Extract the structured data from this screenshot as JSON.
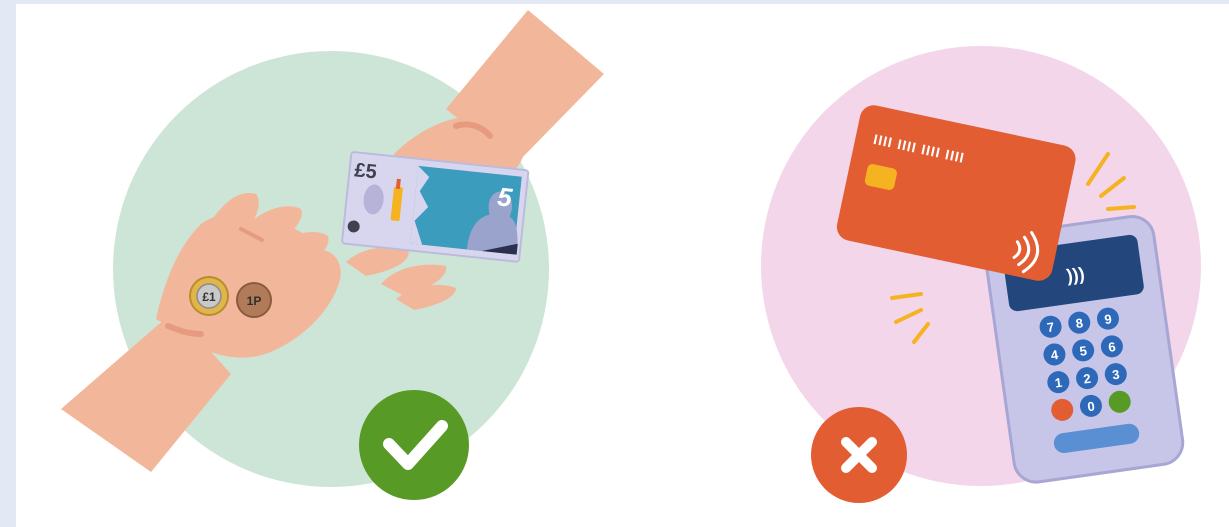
{
  "cash_panel": {
    "note_symbol": "£5",
    "note_numeral": "5",
    "coin_large_label": "£1",
    "coin_small_label": "1P",
    "verdict": "accepted",
    "verdict_icon": "check-icon"
  },
  "card_panel": {
    "card_number_mask": "IIII IIII IIII IIII",
    "keypad_digits": [
      "7",
      "8",
      "9",
      "4",
      "5",
      "6",
      "1",
      "2",
      "3",
      "0"
    ],
    "verdict": "rejected",
    "verdict_icon": "cross-icon"
  },
  "colors": {
    "page_border": "#e3e8f5",
    "cash_circle": "#cde5d6",
    "card_circle": "#f3d6ea",
    "skin": "#f2b79a",
    "skin_shadow": "#e69b80",
    "card_orange": "#e35d33",
    "terminal": "#c7c6e8",
    "terminal_screen": "#23467d",
    "key_blue": "#2e69b9",
    "check_green": "#579a26",
    "cross_orange": "#e35d33",
    "accent_yellow": "#f5b321"
  }
}
